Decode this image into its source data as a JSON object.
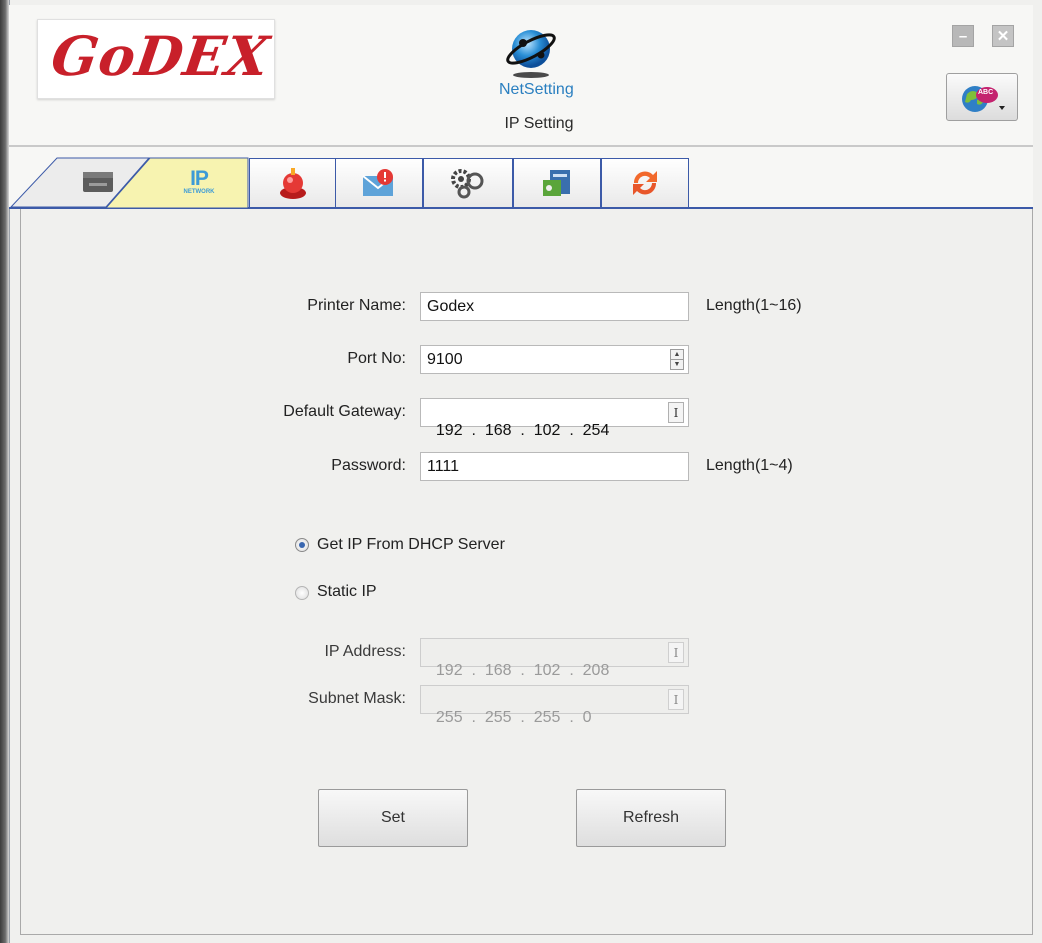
{
  "header": {
    "logo_text": "GoDEX",
    "app_name": "NetSetting",
    "title": "IP Setting",
    "minimize_label": "–",
    "close_label": "✕",
    "language_badge": "ABC"
  },
  "tabs": [
    {
      "id": "printer",
      "icon": "printer-icon",
      "label": ""
    },
    {
      "id": "network",
      "icon": "ip-network-icon",
      "label": "IP",
      "sublabel": "NETWORK",
      "active": true
    },
    {
      "id": "alert",
      "icon": "alert-bell-icon",
      "label": ""
    },
    {
      "id": "mail",
      "icon": "mail-alert-icon",
      "label": ""
    },
    {
      "id": "settings",
      "icon": "gears-icon",
      "label": ""
    },
    {
      "id": "key",
      "icon": "key-card-icon",
      "label": ""
    },
    {
      "id": "refresh",
      "icon": "refresh-arrows-icon",
      "label": ""
    }
  ],
  "form": {
    "printer_name": {
      "label": "Printer Name:",
      "value": "Godex",
      "hint": "Length(1~16)"
    },
    "port_no": {
      "label": "Port No:",
      "value": "9100"
    },
    "default_gateway": {
      "label": "Default Gateway:",
      "value": "192  .  168  .  102  .  254"
    },
    "password": {
      "label": "Password:",
      "value": "1111",
      "hint": "Length(1~4)"
    },
    "dhcp": {
      "label": "Get IP From DHCP Server",
      "selected": true
    },
    "static_ip": {
      "label": "Static IP",
      "selected": false
    },
    "ip_address": {
      "label": "IP Address:",
      "value": "192  .  168  .  102  .  208",
      "disabled": true
    },
    "subnet_mask": {
      "label": "Subnet Mask:",
      "value": "255  .  255  .  255  .  0",
      "disabled": true
    }
  },
  "buttons": {
    "set_label": "Set",
    "refresh_label": "Refresh"
  },
  "colors": {
    "logo_red": "#c8202a",
    "netsetting_blue": "#2a7fc0",
    "tab_border": "#3c5aa8",
    "active_tab": "#f6f2a8"
  }
}
